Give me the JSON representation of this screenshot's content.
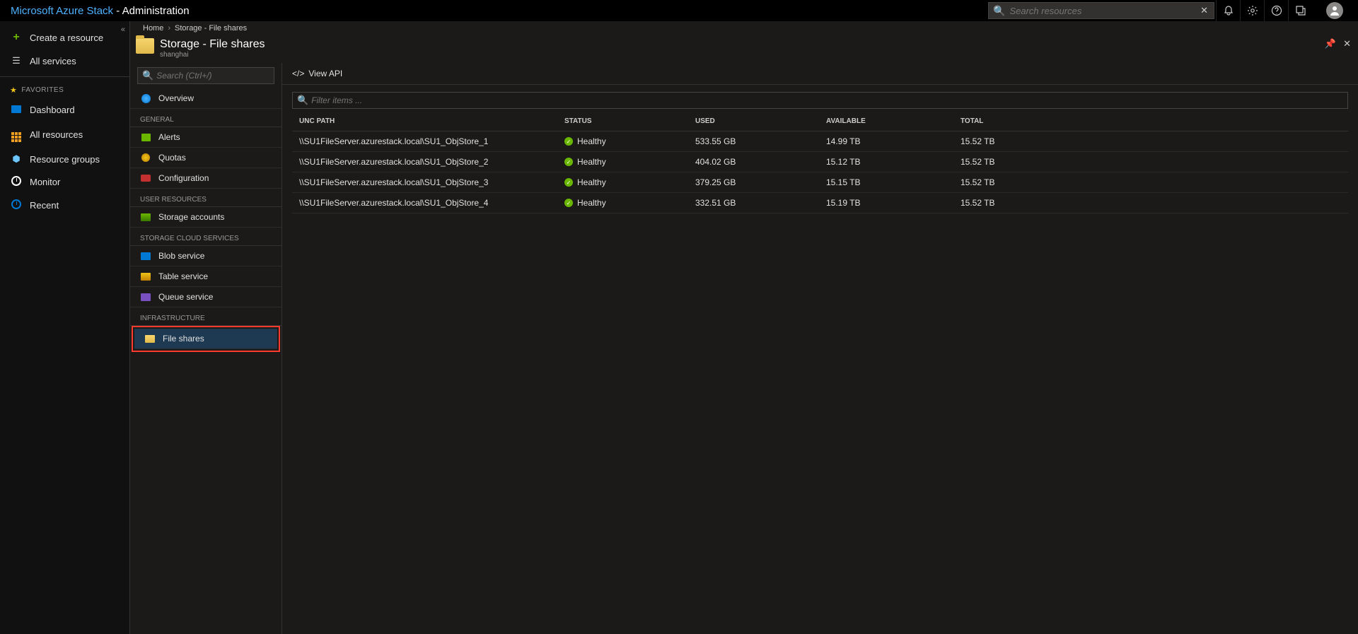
{
  "topbar": {
    "title_prefix": "Microsoft Azure Stack",
    "title_suffix": " - Administration",
    "search_placeholder": "Search resources"
  },
  "leftnav": {
    "create": "Create a resource",
    "all_services": "All services",
    "favorites_label": "FAVORITES",
    "items": [
      {
        "label": "Dashboard"
      },
      {
        "label": "All resources"
      },
      {
        "label": "Resource groups"
      },
      {
        "label": "Monitor"
      },
      {
        "label": "Recent"
      }
    ]
  },
  "breadcrumb": {
    "home": "Home",
    "current": "Storage - File shares"
  },
  "blade": {
    "title": "Storage - File shares",
    "subtitle": "shanghai",
    "search_placeholder": "Search (Ctrl+/)",
    "overview": "Overview",
    "sections": {
      "general": "GENERAL",
      "general_items": [
        "Alerts",
        "Quotas",
        "Configuration"
      ],
      "user": "USER RESOURCES",
      "user_items": [
        "Storage accounts"
      ],
      "cloud": "STORAGE CLOUD SERVICES",
      "cloud_items": [
        "Blob service",
        "Table service",
        "Queue service"
      ],
      "infra": "INFRASTRUCTURE",
      "infra_items": [
        "File shares"
      ]
    }
  },
  "main": {
    "view_api": "View API",
    "filter_placeholder": "Filter items ...",
    "columns": {
      "path": "UNC PATH",
      "status": "STATUS",
      "used": "USED",
      "available": "AVAILABLE",
      "total": "TOTAL"
    },
    "rows": [
      {
        "path": "\\\\SU1FileServer.azurestack.local\\SU1_ObjStore_1",
        "status": "Healthy",
        "used": "533.55 GB",
        "available": "14.99 TB",
        "total": "15.52 TB"
      },
      {
        "path": "\\\\SU1FileServer.azurestack.local\\SU1_ObjStore_2",
        "status": "Healthy",
        "used": "404.02 GB",
        "available": "15.12 TB",
        "total": "15.52 TB"
      },
      {
        "path": "\\\\SU1FileServer.azurestack.local\\SU1_ObjStore_3",
        "status": "Healthy",
        "used": "379.25 GB",
        "available": "15.15 TB",
        "total": "15.52 TB"
      },
      {
        "path": "\\\\SU1FileServer.azurestack.local\\SU1_ObjStore_4",
        "status": "Healthy",
        "used": "332.51 GB",
        "available": "15.19 TB",
        "total": "15.52 TB"
      }
    ]
  }
}
